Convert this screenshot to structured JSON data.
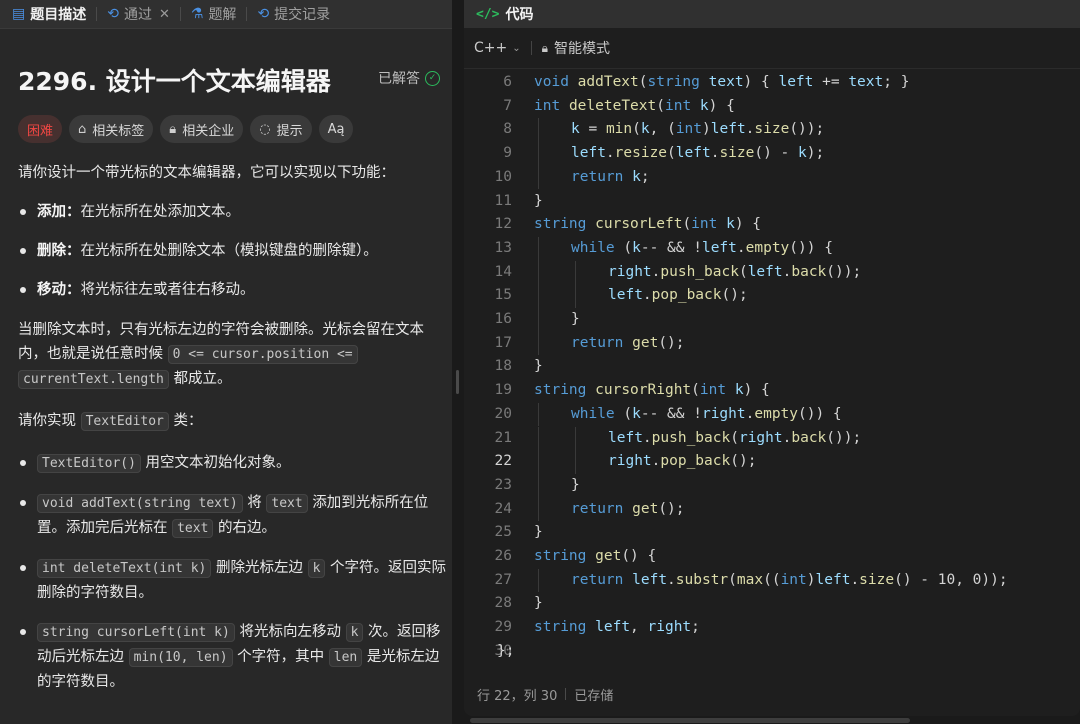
{
  "left_tabs": [
    {
      "label": "题目描述",
      "icon": "description-icon"
    },
    {
      "label": "通过",
      "icon": "accepted-icon"
    },
    {
      "label": "题解",
      "icon": "solution-icon"
    },
    {
      "label": "提交记录",
      "icon": "history-icon"
    }
  ],
  "problem": {
    "title": "2296. 设计一个文本编辑器",
    "status": "已解答",
    "tags": [
      "困难",
      "相关标签",
      "相关企业",
      "提示",
      "Aą"
    ]
  },
  "desc": {
    "intro": "请你设计一个带光标的文本编辑器，它可以实现以下功能：",
    "features": [
      {
        "name": "添加：",
        "text": "在光标所在处添加文本。"
      },
      {
        "name": "删除：",
        "text": "在光标所在处删除文本（模拟键盘的删除键）。"
      },
      {
        "name": "移动：",
        "text": "将光标往左或者往右移动。"
      }
    ],
    "delete_note_1": "当删除文本时，只有光标左边的字符会被删除。光标会留在文本内，也就是说任意时候",
    "delete_note_code_a": "0 <= cursor.position <=",
    "delete_note_code_b": "currentText.length",
    "delete_note_2": "都成立。",
    "impl_1": "请你实现",
    "impl_code": "TextEditor",
    "impl_2": "类：",
    "methods": [
      {
        "code": "TextEditor()",
        "t1": "用空文本初始化对象。"
      },
      {
        "code": "void addText(string text)",
        "t1": "将",
        "code2": "text",
        "t2": "添加到光标所在位置。添加完后光标在",
        "code3": "text",
        "t3": "的右边。"
      },
      {
        "code": "int deleteText(int k)",
        "t1": "删除光标左边",
        "code2": "k",
        "t2": "个字符。返回实际删除的字符数目。"
      },
      {
        "code": "string cursorLeft(int k)",
        "t1": "将光标向左移动",
        "code2": "k",
        "t2": "次。返回移动后光标左边",
        "code3": "min(10, len)",
        "t3": "个字符，其中",
        "code4": "len",
        "t4": "是光标左边的字符数目。"
      }
    ]
  },
  "code_panel": {
    "title": "代码",
    "language": "C++",
    "mode": "智能模式",
    "current_line": 22,
    "lines": [
      {
        "n": 6,
        "indent": 1,
        "code": "void addText(string text) { left += text; }"
      },
      {
        "n": 7,
        "indent": 1,
        "code": "int deleteText(int k) {"
      },
      {
        "n": 8,
        "indent": 2,
        "code": "k = min(k, (int)left.size());"
      },
      {
        "n": 9,
        "indent": 2,
        "code": "left.resize(left.size() - k);"
      },
      {
        "n": 10,
        "indent": 2,
        "code": "return k;"
      },
      {
        "n": 11,
        "indent": 1,
        "code": "}"
      },
      {
        "n": 12,
        "indent": 1,
        "code": "string cursorLeft(int k) {"
      },
      {
        "n": 13,
        "indent": 2,
        "code": "while (k-- && !left.empty()) {"
      },
      {
        "n": 14,
        "indent": 3,
        "code": "right.push_back(left.back());"
      },
      {
        "n": 15,
        "indent": 3,
        "code": "left.pop_back();"
      },
      {
        "n": 16,
        "indent": 2,
        "code": "}"
      },
      {
        "n": 17,
        "indent": 2,
        "code": "return get();"
      },
      {
        "n": 18,
        "indent": 1,
        "code": "}"
      },
      {
        "n": 19,
        "indent": 1,
        "code": "string cursorRight(int k) {"
      },
      {
        "n": 20,
        "indent": 2,
        "code": "while (k-- && !right.empty()) {"
      },
      {
        "n": 21,
        "indent": 3,
        "code": "left.push_back(right.back());"
      },
      {
        "n": 22,
        "indent": 3,
        "code": "right.pop_back();"
      },
      {
        "n": 23,
        "indent": 2,
        "code": "}"
      },
      {
        "n": 24,
        "indent": 2,
        "code": "return get();"
      },
      {
        "n": 25,
        "indent": 1,
        "code": "}"
      },
      {
        "n": 26,
        "indent": 1,
        "code": "string get() {"
      },
      {
        "n": 27,
        "indent": 2,
        "code": "return left.substr(max((int)left.size() - 10, 0));"
      },
      {
        "n": 28,
        "indent": 1,
        "code": "}"
      },
      {
        "n": 29,
        "indent": 1,
        "code": "string left, right;"
      },
      {
        "n": 30,
        "indent": 0,
        "code": "};"
      }
    ],
    "status_position": "行 22，列 30",
    "status_saved": "已存储"
  },
  "colors": {
    "accent_green": "#2cbb5d",
    "hard_red": "#ef4743",
    "keyword": "#569cd6",
    "function": "#dcdcaa",
    "variable": "#9cdcfe"
  }
}
